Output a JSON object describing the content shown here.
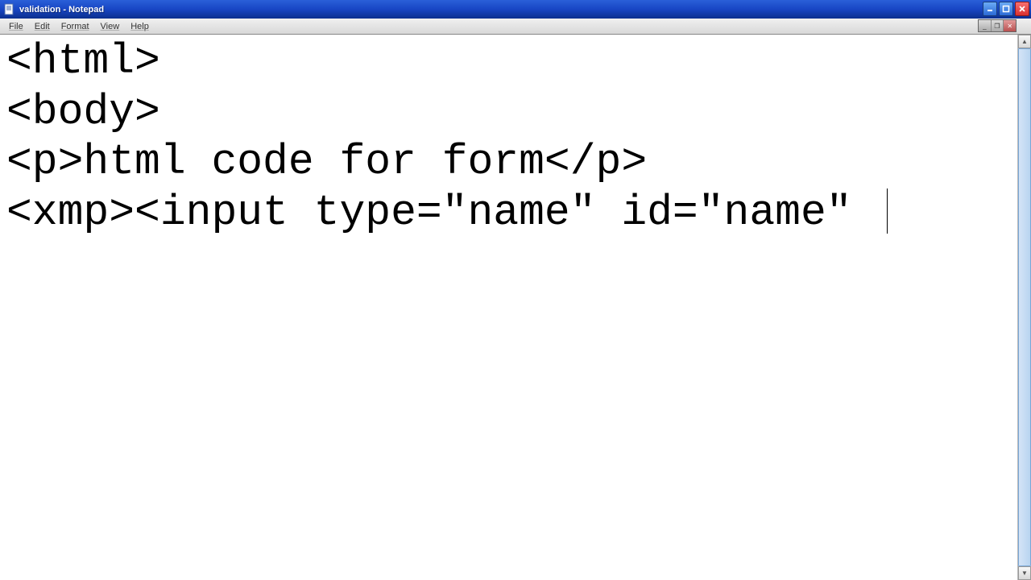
{
  "window": {
    "title": "validation - Notepad"
  },
  "menu": {
    "file": "File",
    "edit": "Edit",
    "format": "Format",
    "view": "View",
    "help": "Help"
  },
  "editor": {
    "content": "<html>\n<body>\n<p>html code for form</p>\n<xmp><input type=\"name\" id=\"name\" "
  }
}
